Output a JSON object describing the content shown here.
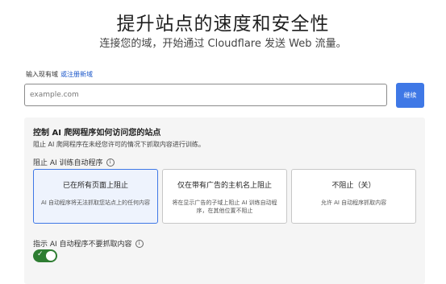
{
  "hero": {
    "title": "提升站点的速度和安全性",
    "subtitle": "连接您的域，开始通过 Cloudflare 发送 Web 流量。"
  },
  "domain": {
    "label": "输入现有域",
    "register_link": "或注册新域",
    "input_placeholder": "example.com",
    "input_value": "",
    "continue_label": "继续"
  },
  "ai_crawl": {
    "title": "控制 AI 爬网程序如何访问您的站点",
    "description": "阻止 AI 爬网程序在未经您许可的情况下抓取内容进行训练。",
    "block_label": "阻止 AI 训练自动程序",
    "options": [
      {
        "title": "已在所有页面上阻止",
        "desc": "AI 自动程序将无法抓取您站点上的任何内容",
        "selected": true
      },
      {
        "title": "仅在带有广告的主机名上阻止",
        "desc": "将在显示广告的子域上阻止 AI 训练自动程序，在其他位置不阻止",
        "selected": false
      },
      {
        "title": "不阻止（关）",
        "desc": "允许 AI 自动程序抓取内容",
        "selected": false
      }
    ],
    "directive_label": "指示 AI 自动程序不要抓取内容",
    "directive_enabled": true
  },
  "icons": {
    "info": "info-icon",
    "check": "check-icon"
  },
  "colors": {
    "accent": "#3f78e6",
    "toggle_on": "#2e7d32",
    "link": "#1a56c9"
  }
}
